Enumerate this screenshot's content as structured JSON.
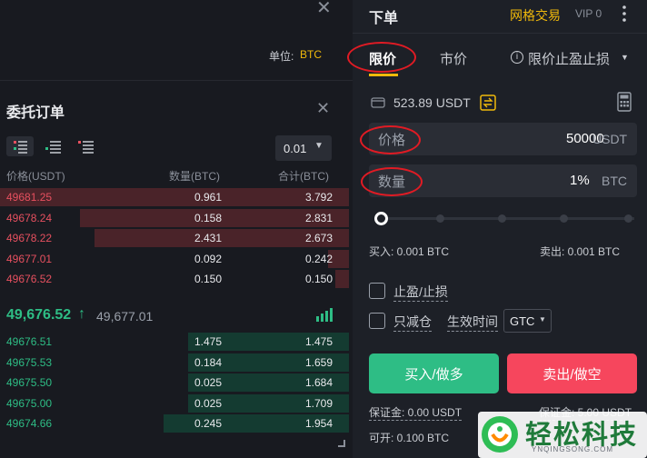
{
  "top": {
    "unit_label": "单位:",
    "unit_value": "BTC"
  },
  "orders": {
    "title": "委托订单"
  },
  "orderbook": {
    "precision": "0.01",
    "headers": {
      "price": "价格(USDT)",
      "qty": "数量(BTC)",
      "total": "合计(BTC)"
    },
    "asks": [
      {
        "price": "49681.25",
        "qty": "0.961",
        "total": "3.792",
        "depth": 1.0
      },
      {
        "price": "49678.24",
        "qty": "0.158",
        "total": "2.831",
        "depth": 0.77
      },
      {
        "price": "49678.22",
        "qty": "2.431",
        "total": "2.673",
        "depth": 0.73
      },
      {
        "price": "49677.01",
        "qty": "0.092",
        "total": "0.242",
        "depth": 0.06
      },
      {
        "price": "49676.52",
        "qty": "0.150",
        "total": "0.150",
        "depth": 0.04
      }
    ],
    "last_price": "49,676.52",
    "last_arrow": "↑",
    "mark_price": "49,677.01",
    "bids": [
      {
        "price": "49676.51",
        "qty": "1.475",
        "total": "1.475",
        "depth": 0.46
      },
      {
        "price": "49675.53",
        "qty": "0.184",
        "total": "1.659",
        "depth": 0.46
      },
      {
        "price": "49675.50",
        "qty": "0.025",
        "total": "1.684",
        "depth": 0.46
      },
      {
        "price": "49675.00",
        "qty": "0.025",
        "total": "1.709",
        "depth": 0.46
      },
      {
        "price": "49674.66",
        "qty": "0.245",
        "total": "1.954",
        "depth": 0.53
      }
    ]
  },
  "panel": {
    "title": "下单",
    "grid": "网格交易",
    "vip": "VIP 0",
    "tabs": {
      "limit": "限价",
      "market": "市价",
      "tpsl": "限价止盈止损"
    },
    "balance": "523.89 USDT",
    "price_label": "价格",
    "price_value": "50000",
    "price_unit": "USDT",
    "amount_label": "数量",
    "amount_value": "1%",
    "amount_unit": "BTC",
    "slider_percent": 1,
    "buy_info": "买入: 0.001 BTC",
    "sell_info": "卖出: 0.001 BTC",
    "tpsl_check": "止盈/止损",
    "reduce_only": "只减仓",
    "tif_label": "生效时间",
    "tif_value": "GTC",
    "buy_button": "买入/做多",
    "sell_button": "卖出/做空",
    "margin_buy": "保证金: 0.00 USDT",
    "margin_sell": "保证金: 5.00 USDT",
    "open_buy": "可开: 0.100 BTC"
  },
  "watermark": {
    "name": "轻松科技",
    "url": "YNQINGSONG.COM"
  },
  "colors": {
    "accent": "#f0b90b",
    "buy": "#2ebd85",
    "sell": "#f6465d",
    "annotation": "#e01b24"
  }
}
